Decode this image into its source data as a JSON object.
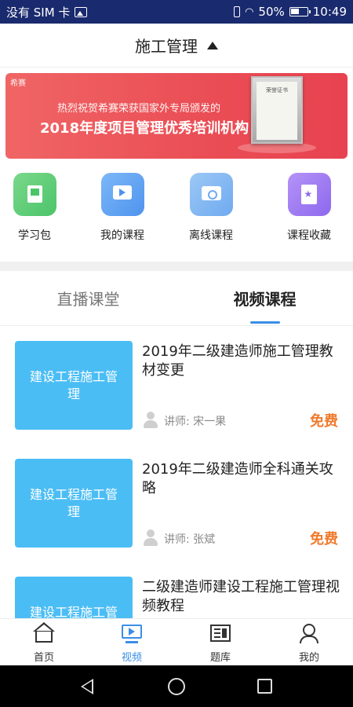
{
  "status_bar": {
    "carrier": "没有 SIM 卡",
    "battery": "50%",
    "time": "10:49"
  },
  "header": {
    "title": "施工管理"
  },
  "banner": {
    "brand": "希赛",
    "line1": "热烈祝贺希赛荣获国家外专局颁发的",
    "line2": "2018年度项目管理优秀培训机构",
    "plaque_title": "荣誉证书"
  },
  "quick_nav": [
    {
      "label": "学习包",
      "icon": "book-icon"
    },
    {
      "label": "我的课程",
      "icon": "video-course-icon"
    },
    {
      "label": "离线课程",
      "icon": "offline-icon"
    },
    {
      "label": "课程收藏",
      "icon": "favorite-icon"
    }
  ],
  "tabs": [
    {
      "label": "直播课堂",
      "active": false
    },
    {
      "label": "视频课程",
      "active": true
    }
  ],
  "courses": [
    {
      "thumb": "建设工程施工管理",
      "title": "2019年二级建造师施工管理教材变更",
      "teacher": "讲师: 宋一果",
      "price": "免费"
    },
    {
      "thumb": "建设工程施工管理",
      "title": "2019年二级建造师全科通关攻略",
      "teacher": "讲师: 张斌",
      "price": "免费"
    },
    {
      "thumb": "建设工程施工管理",
      "title": "二级建造师建设工程施工管理视频教程",
      "teacher": "",
      "price": ""
    }
  ],
  "bottom_nav": [
    {
      "label": "首页",
      "active": false
    },
    {
      "label": "视频",
      "active": true
    },
    {
      "label": "题库",
      "active": false
    },
    {
      "label": "我的",
      "active": false
    }
  ],
  "colors": {
    "accent": "#3a8ee6",
    "price": "#f07a2c",
    "thumb": "#4bbdf5",
    "banner": "#ea4d55"
  }
}
